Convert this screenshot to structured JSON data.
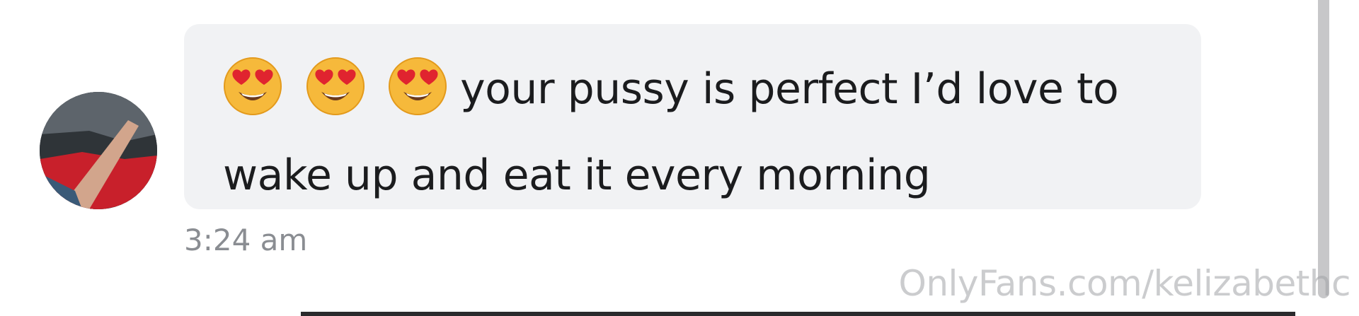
{
  "message": {
    "emojis": [
      "heart-eyes-emoji",
      "heart-eyes-emoji",
      "heart-eyes-emoji"
    ],
    "line1": "your pussy is perfect I’d love to",
    "line2": "wake up and eat it every morning",
    "timestamp": "3:24 am"
  },
  "watermark": "OnlyFans.com/kelizabethc",
  "colors": {
    "bubble": "#f1f2f4",
    "text": "#1b1c1e",
    "timestamp": "#8a8d92",
    "emoji_face": "#f6b93b",
    "emoji_heart": "#e0242f"
  }
}
